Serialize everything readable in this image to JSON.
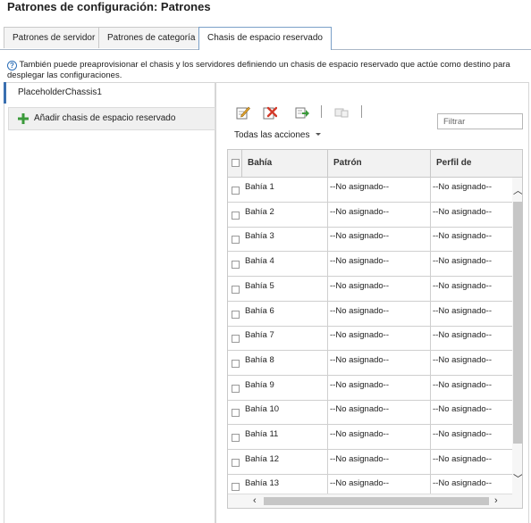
{
  "page": {
    "title": "Patrones de configuración: Patrones"
  },
  "tabs": [
    {
      "label": "Patrones de servidor"
    },
    {
      "label": "Patrones de categoría"
    },
    {
      "label": "Chasis de espacio reservado"
    }
  ],
  "info": {
    "text": "También puede preaprovisionar el chasis y los servidores definiendo un chasis de espacio reservado que actúe como destino para desplegar las configuraciones."
  },
  "left": {
    "selected_item": "PlaceholderChassis1",
    "add_button": "Añadir chasis de espacio reservado"
  },
  "toolbar": {
    "icons": [
      "edit-icon",
      "delete-icon",
      "deploy-icon",
      "unassign-icon"
    ],
    "filter_placeholder": "Filtrar",
    "actions_label": "Todas las acciones"
  },
  "table": {
    "columns": [
      "Bahía",
      "Patrón",
      "Perfil de"
    ],
    "rows": [
      {
        "bay": "Bahía 1",
        "pattern": "--No asignado--",
        "profile": "--No asignado--"
      },
      {
        "bay": "Bahía 2",
        "pattern": "--No asignado--",
        "profile": "--No asignado--"
      },
      {
        "bay": "Bahía 3",
        "pattern": "--No asignado--",
        "profile": "--No asignado--"
      },
      {
        "bay": "Bahía 4",
        "pattern": "--No asignado--",
        "profile": "--No asignado--"
      },
      {
        "bay": "Bahía 5",
        "pattern": "--No asignado--",
        "profile": "--No asignado--"
      },
      {
        "bay": "Bahía 6",
        "pattern": "--No asignado--",
        "profile": "--No asignado--"
      },
      {
        "bay": "Bahía 7",
        "pattern": "--No asignado--",
        "profile": "--No asignado--"
      },
      {
        "bay": "Bahía 8",
        "pattern": "--No asignado--",
        "profile": "--No asignado--"
      },
      {
        "bay": "Bahía 9",
        "pattern": "--No asignado--",
        "profile": "--No asignado--"
      },
      {
        "bay": "Bahía 10",
        "pattern": "--No asignado--",
        "profile": "--No asignado--"
      },
      {
        "bay": "Bahía 11",
        "pattern": "--No asignado--",
        "profile": "--No asignado--"
      },
      {
        "bay": "Bahía 12",
        "pattern": "--No asignado--",
        "profile": "--No asignado--"
      },
      {
        "bay": "Bahía 13",
        "pattern": "--No asignado--",
        "profile": "--No asignado--"
      }
    ]
  },
  "colors": {
    "accent": "#3a6fb0",
    "info_icon": "#2d6fb7",
    "add_icon": "#3a9a3a",
    "delete_icon": "#d23a2a"
  }
}
